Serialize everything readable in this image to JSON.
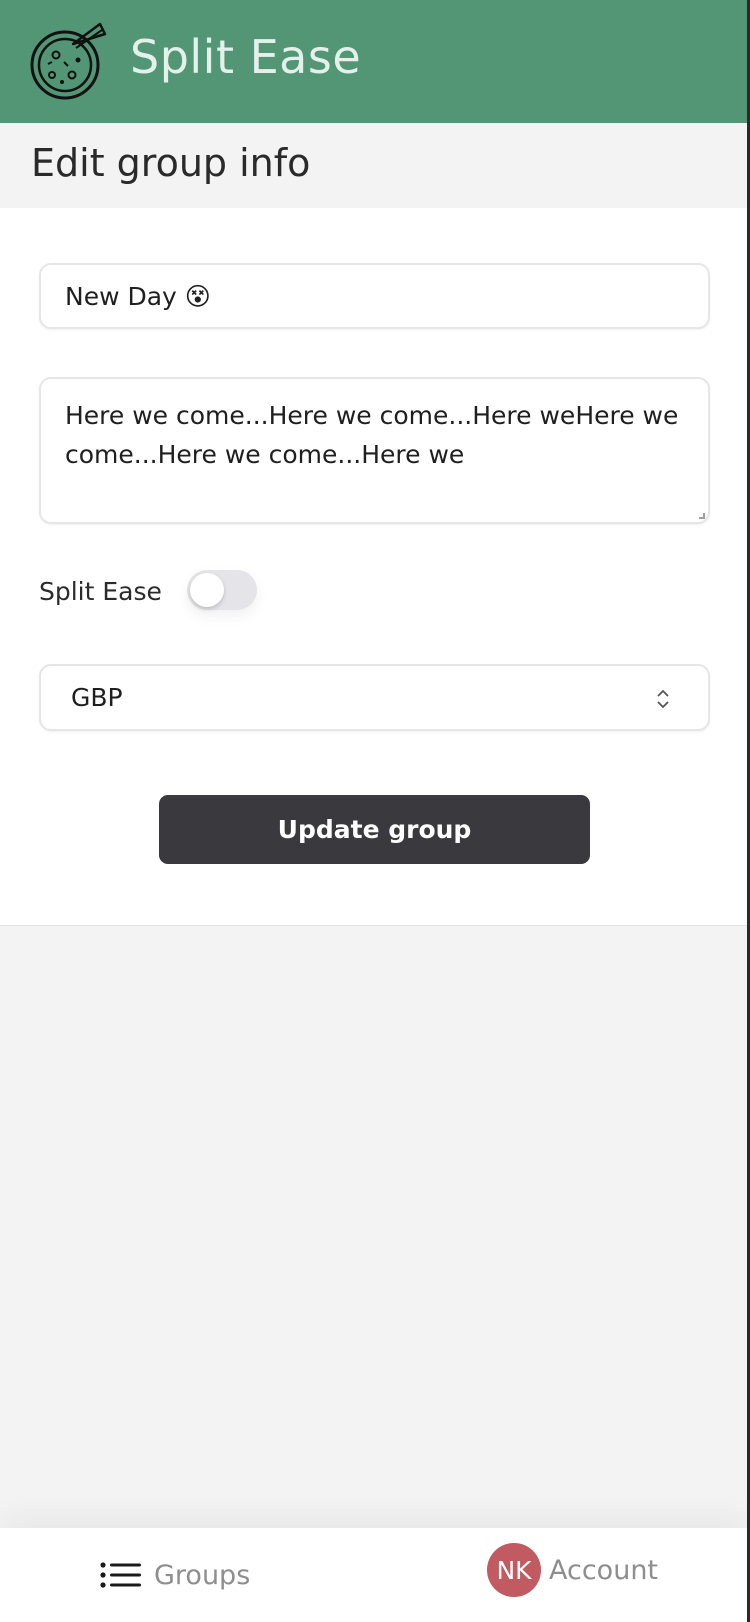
{
  "app": {
    "title": "Split Ease",
    "logo_icon": "pizza-icon"
  },
  "page": {
    "title": "Edit group info"
  },
  "form": {
    "group_name_value": "New Day 😵",
    "description_value": "Here we come...Here we come...Here weHere we come...Here we come...Here we",
    "toggle_label": "Split Ease",
    "toggle_on": false,
    "currency_value": "GBP",
    "submit_label": "Update group"
  },
  "nav": {
    "groups_label": "Groups",
    "groups_icon": "list-icon",
    "account_label": "Account",
    "avatar_initials": "NK"
  },
  "colors": {
    "header": "#529676",
    "button": "#3a393d",
    "avatar": "#c25a62"
  }
}
